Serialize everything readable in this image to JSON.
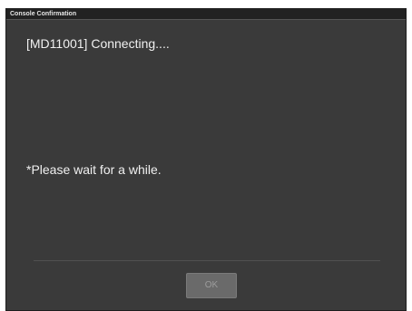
{
  "window": {
    "title": "Console Confirmation"
  },
  "dialog": {
    "message": "[MD11001] Connecting....",
    "note": "*Please wait for a while."
  },
  "buttons": {
    "ok_label": "OK",
    "ok_enabled": false
  },
  "colors": {
    "background": "#3a3a3a",
    "titlebar": "#222222",
    "text": "#f0f0f0",
    "button_disabled": "#6a6a6a"
  }
}
